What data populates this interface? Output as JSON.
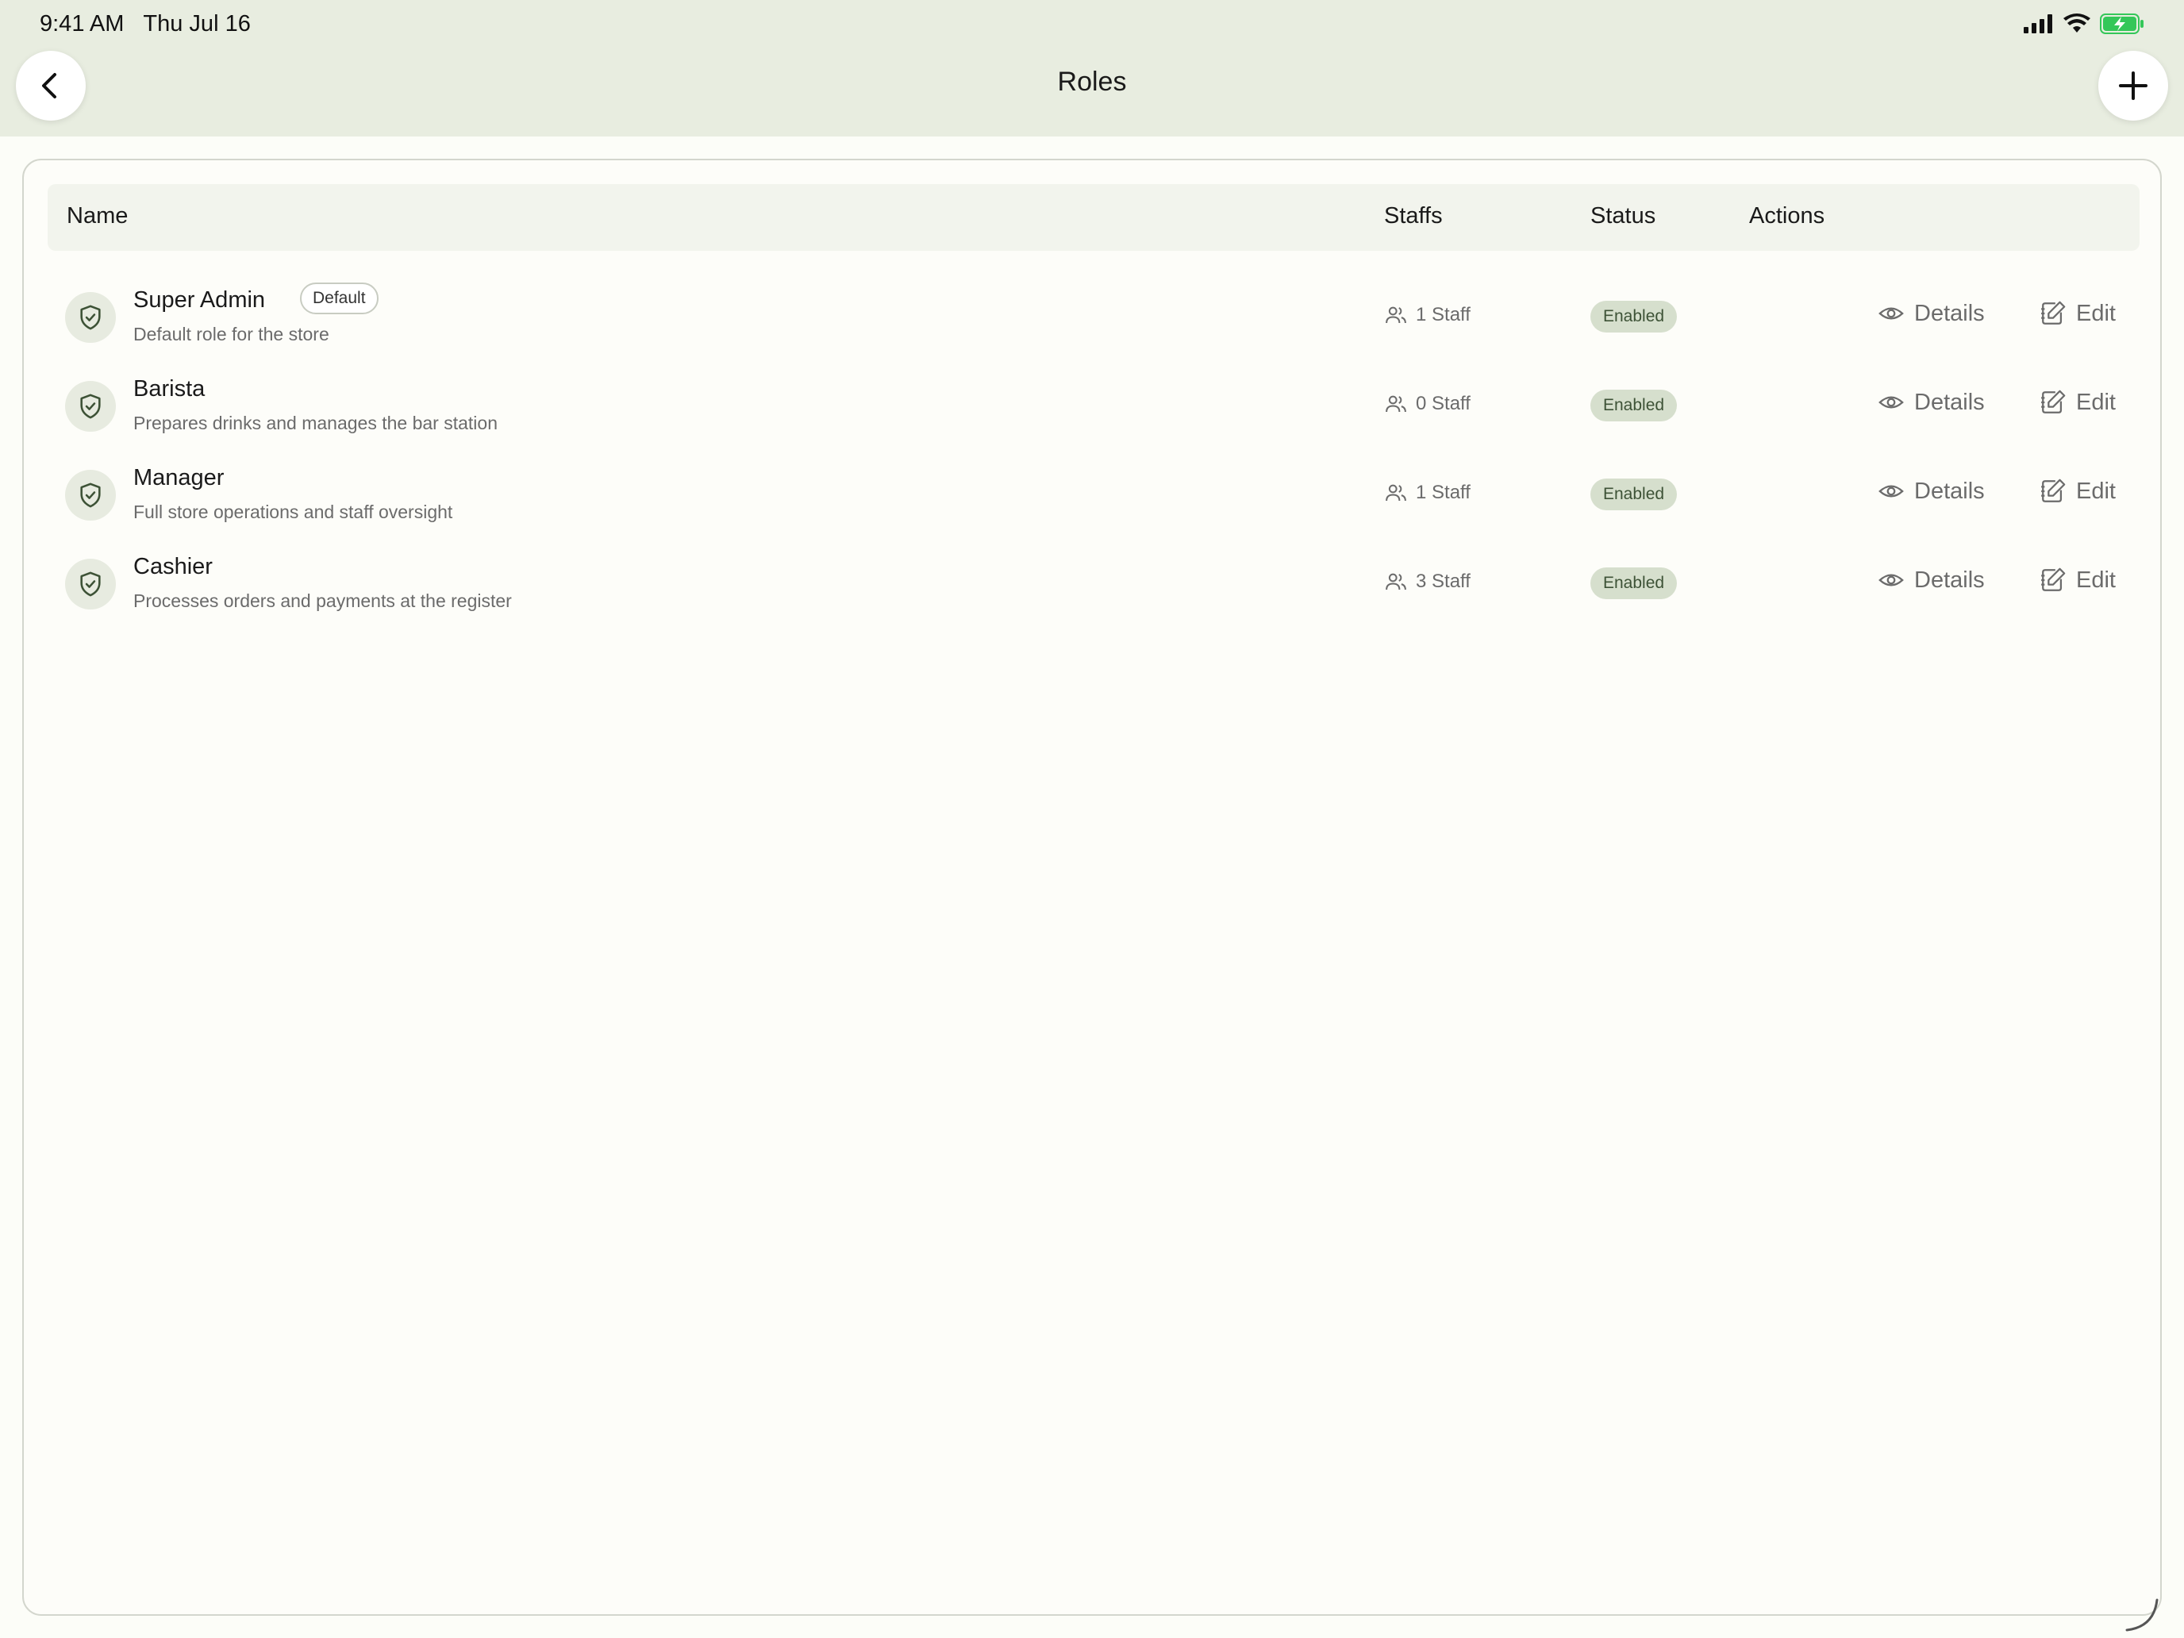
{
  "status_bar": {
    "time": "9:41 AM",
    "date": "Thu Jul 16"
  },
  "header": {
    "title": "Roles"
  },
  "table": {
    "columns": {
      "name": "Name",
      "staffs": "Staffs",
      "status": "Status",
      "actions": "Actions"
    },
    "rows": [
      {
        "name": "Super Admin",
        "badge": "Default",
        "description": "Default role for the store",
        "staff": "1 Staff",
        "status": "Enabled",
        "details": "Details",
        "edit": "Edit"
      },
      {
        "name": "Barista",
        "description": "Prepares drinks and manages the bar station",
        "staff": "0 Staff",
        "status": "Enabled",
        "details": "Details",
        "edit": "Edit"
      },
      {
        "name": "Manager",
        "description": "Full store operations and staff oversight",
        "staff": "1 Staff",
        "status": "Enabled",
        "details": "Details",
        "edit": "Edit"
      },
      {
        "name": "Cashier",
        "description": "Processes orders and payments at the register",
        "staff": "3 Staff",
        "status": "Enabled",
        "details": "Details",
        "edit": "Edit"
      }
    ]
  },
  "colors": {
    "header_bg": "#e8ede0",
    "accent": "#3d5236",
    "status_pill_bg": "#d6dfcd",
    "battery": "#34c759"
  },
  "icons": [
    "cellular-icon",
    "wifi-icon",
    "battery-charging-icon",
    "back-chevron-icon",
    "plus-icon",
    "shield-check-icon",
    "users-icon",
    "eye-icon",
    "edit-icon"
  ]
}
